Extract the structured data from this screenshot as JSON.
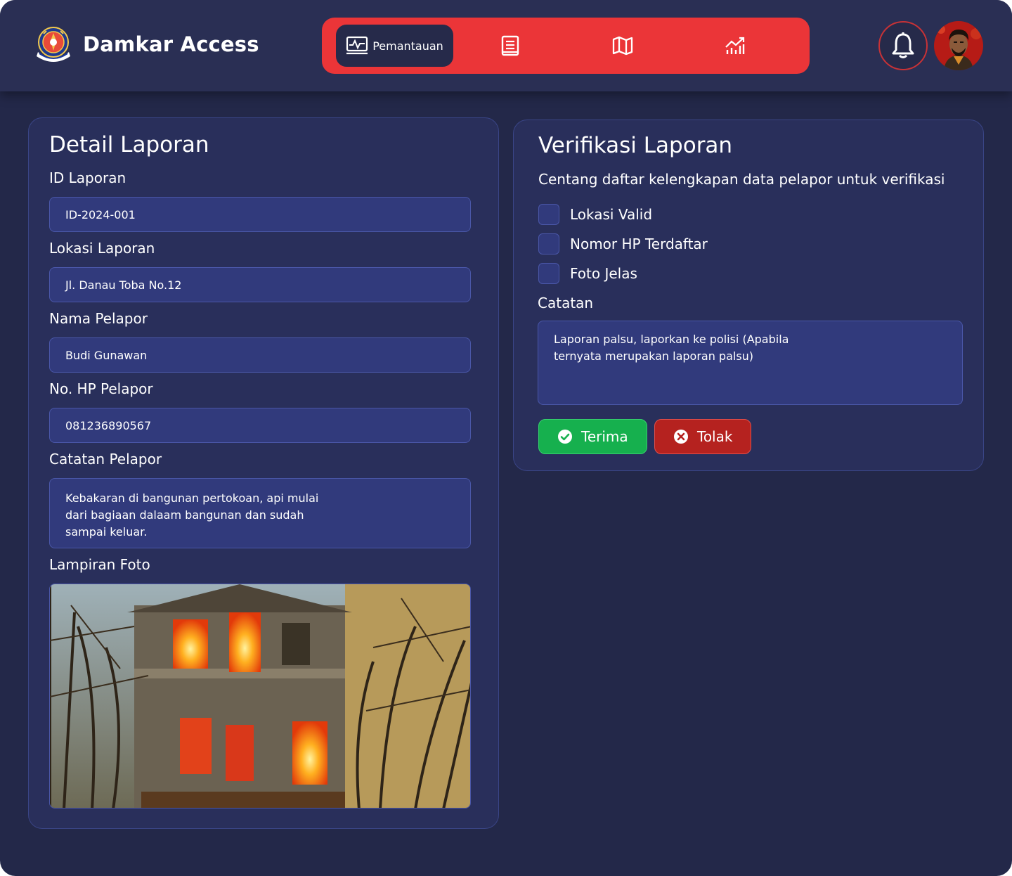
{
  "header": {
    "app_title": "Damkar Access",
    "nav": {
      "tabs": [
        {
          "label": "Pemantauan",
          "icon": "monitor-activity-icon",
          "active": true
        },
        {
          "label": "",
          "icon": "report-document-icon",
          "active": false
        },
        {
          "label": "",
          "icon": "map-icon",
          "active": false
        },
        {
          "label": "",
          "icon": "analytics-chart-icon",
          "active": false
        }
      ]
    },
    "notification_icon": "bell-icon",
    "accent_color": "#eb3538"
  },
  "detail": {
    "title": "Detail Laporan",
    "id_label": "ID Laporan",
    "id_value": "ID-2024-001",
    "location_label": "Lokasi Laporan",
    "location_value": "Jl. Danau Toba No.12",
    "reporter_label": "Nama Pelapor",
    "reporter_value": "Budi Gunawan",
    "phone_label": "No. HP Pelapor",
    "phone_value": "081236890567",
    "note_label": "Catatan Pelapor",
    "note_value": "Kebakaran di bangunan pertokoan, api mulai dari bagiaan dalaam bangunan dan sudah sampai keluar.",
    "photo_label": "Lampiran Foto"
  },
  "verify": {
    "title": "Verifikasi Laporan",
    "subtitle": "Centang daftar kelengkapan data pelapor untuk verifikasi",
    "checks": [
      {
        "label": "Lokasi Valid",
        "checked": false
      },
      {
        "label": "Nomor HP Terdaftar",
        "checked": false
      },
      {
        "label": "Foto Jelas",
        "checked": false
      }
    ],
    "notes_label": "Catatan",
    "notes_value": "Laporan palsu, laporkan ke polisi (Apabila ternyata merupakan laporan palsu)",
    "accept_label": "Terima",
    "reject_label": "Tolak",
    "accept_color": "#16b04e",
    "reject_color": "#b5221f"
  }
}
